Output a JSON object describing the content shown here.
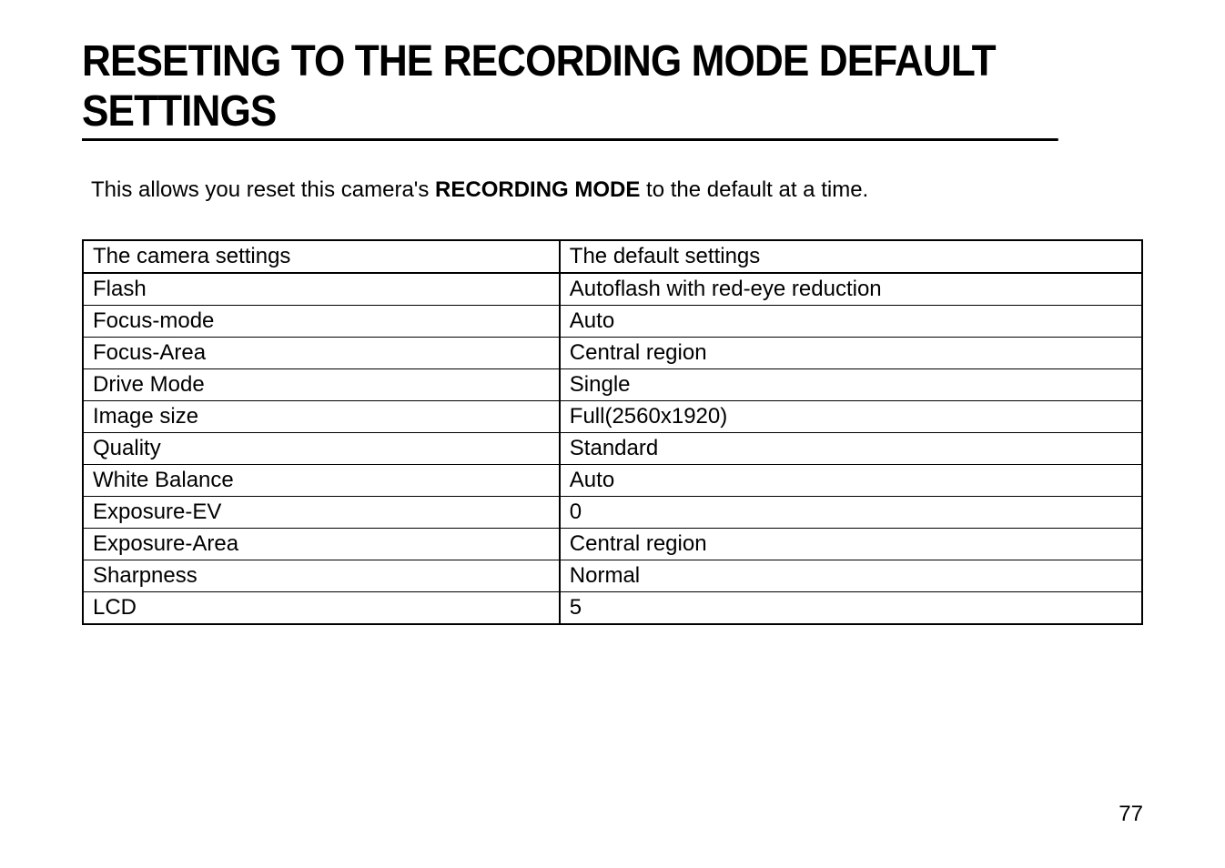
{
  "title": "RESETING TO THE RECORDING MODE DEFAULT SETTINGS",
  "intro_prefix": "This allows you reset this camera's ",
  "intro_bold": "RECORDING MODE",
  "intro_suffix": " to the default at a time.",
  "table": {
    "header_left": "The camera settings",
    "header_right": "The default settings",
    "rows": [
      {
        "setting": "Flash",
        "default": "Autoflash with red-eye reduction"
      },
      {
        "setting": "Focus-mode",
        "default": "Auto"
      },
      {
        "setting": "Focus-Area",
        "default": "Central region"
      },
      {
        "setting": "Drive Mode",
        "default": "Single"
      },
      {
        "setting": "Image size",
        "default": "Full(2560x1920)"
      },
      {
        "setting": "Quality",
        "default": "Standard"
      },
      {
        "setting": "White Balance",
        "default": "Auto"
      },
      {
        "setting": "Exposure-EV",
        "default": "0"
      },
      {
        "setting": "Exposure-Area",
        "default": "Central region"
      },
      {
        "setting": "Sharpness",
        "default": "Normal"
      },
      {
        "setting": "LCD",
        "default": "5"
      }
    ]
  },
  "page_number": "77"
}
